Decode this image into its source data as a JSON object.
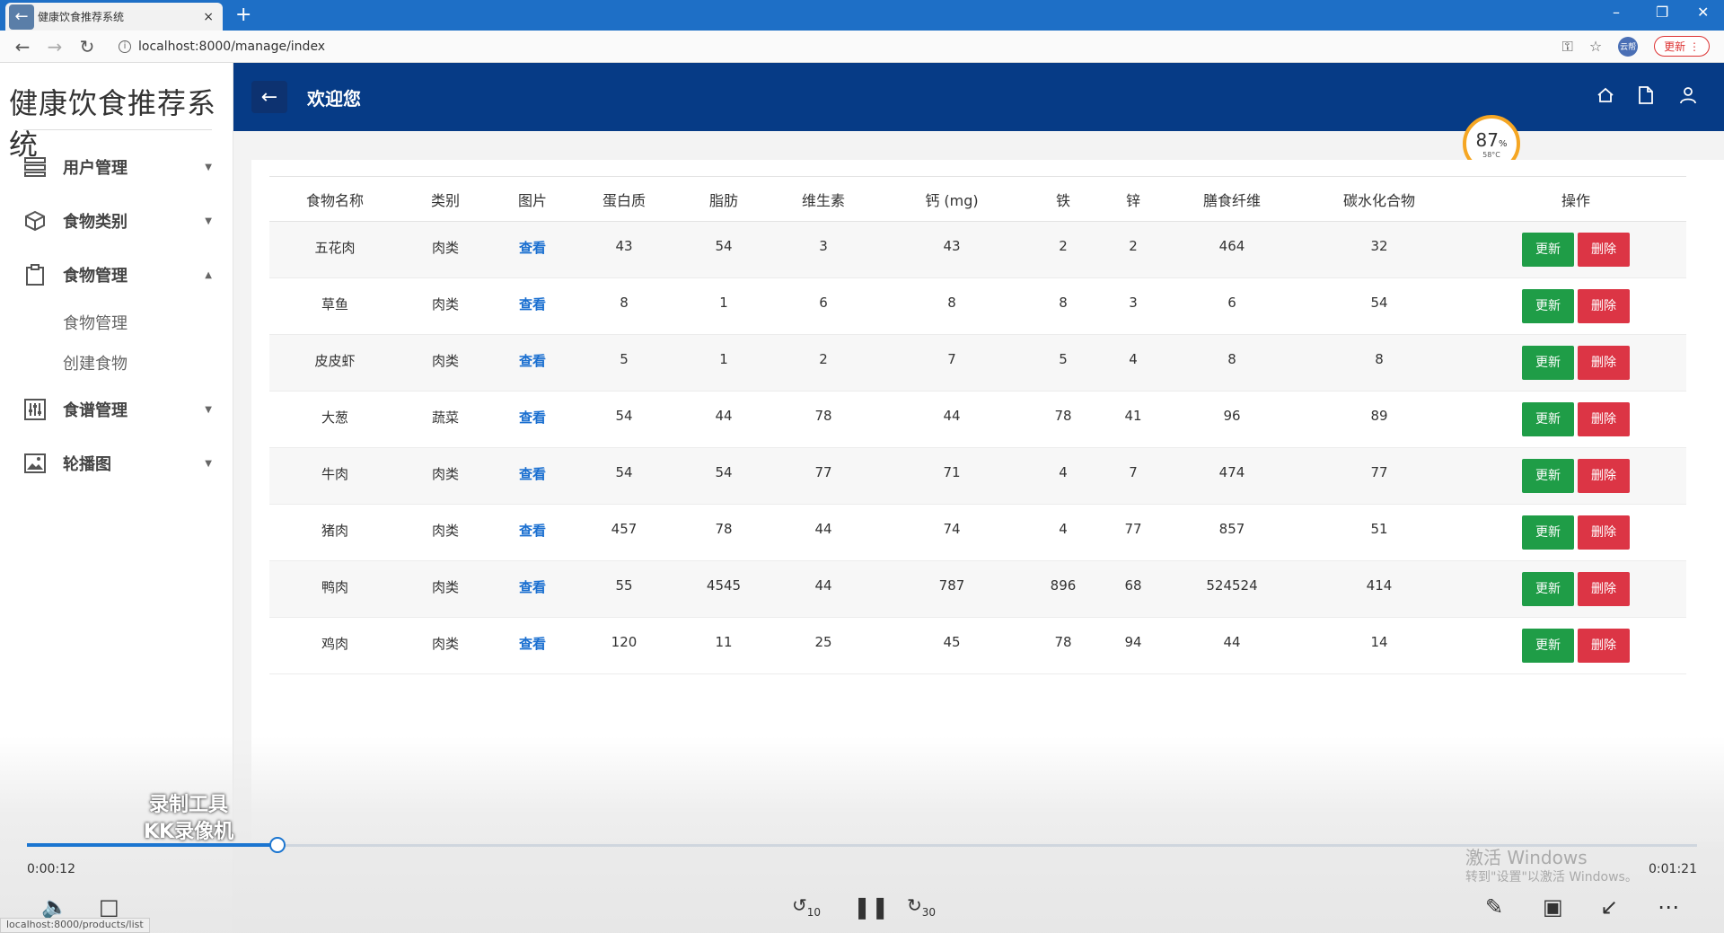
{
  "browser": {
    "tab_title": "健康饮食推荐系统",
    "tab_close": "×",
    "new_tab": "+",
    "url": "localhost:8000/manage/index",
    "update_label": "更新",
    "profile_label": "云帮"
  },
  "sidebar": {
    "app_title": "健康饮食推荐系统",
    "menu": [
      {
        "label": "用户管理",
        "icon": "list-icon"
      },
      {
        "label": "食物类别",
        "icon": "box-icon"
      },
      {
        "label": "食物管理",
        "icon": "clipboard-icon",
        "expanded": true,
        "children": [
          "食物管理",
          "创建食物"
        ]
      },
      {
        "label": "食谱管理",
        "icon": "sliders-icon"
      },
      {
        "label": "轮播图",
        "icon": "image-icon"
      }
    ]
  },
  "header": {
    "title": "欢迎您"
  },
  "badge": {
    "percent": "87",
    "percent_sign": "%",
    "temp": "58°C"
  },
  "table": {
    "columns": [
      "食物名称",
      "类别",
      "图片",
      "蛋白质",
      "脂肪",
      "维生素",
      "钙 (mg)",
      "铁",
      "锌",
      "膳食纤维",
      "碳水化合物",
      "操作"
    ],
    "view_label": "查看",
    "update_label": "更新",
    "delete_label": "删除",
    "rows": [
      {
        "name": "五花肉",
        "category": "肉类",
        "protein": "43",
        "fat": "54",
        "vitamin": "3",
        "calcium": "43",
        "iron": "2",
        "zinc": "2",
        "fiber": "464",
        "carbs": "32"
      },
      {
        "name": "草鱼",
        "category": "肉类",
        "protein": "8",
        "fat": "1",
        "vitamin": "6",
        "calcium": "8",
        "iron": "8",
        "zinc": "3",
        "fiber": "6",
        "carbs": "54"
      },
      {
        "name": "皮皮虾",
        "category": "肉类",
        "protein": "5",
        "fat": "1",
        "vitamin": "2",
        "calcium": "7",
        "iron": "5",
        "zinc": "4",
        "fiber": "8",
        "carbs": "8"
      },
      {
        "name": "大葱",
        "category": "蔬菜",
        "protein": "54",
        "fat": "44",
        "vitamin": "78",
        "calcium": "44",
        "iron": "78",
        "zinc": "41",
        "fiber": "96",
        "carbs": "89"
      },
      {
        "name": "牛肉",
        "category": "肉类",
        "protein": "54",
        "fat": "54",
        "vitamin": "77",
        "calcium": "71",
        "iron": "4",
        "zinc": "7",
        "fiber": "474",
        "carbs": "77"
      },
      {
        "name": "猪肉",
        "category": "肉类",
        "protein": "457",
        "fat": "78",
        "vitamin": "44",
        "calcium": "74",
        "iron": "4",
        "zinc": "77",
        "fiber": "857",
        "carbs": "51"
      },
      {
        "name": "鸭肉",
        "category": "肉类",
        "protein": "55",
        "fat": "4545",
        "vitamin": "44",
        "calcium": "787",
        "iron": "896",
        "zinc": "68",
        "fiber": "524524",
        "carbs": "414"
      },
      {
        "name": "鸡肉",
        "category": "肉类",
        "protein": "120",
        "fat": "11",
        "vitamin": "25",
        "calcium": "45",
        "iron": "78",
        "zinc": "94",
        "fiber": "44",
        "carbs": "14"
      }
    ]
  },
  "player": {
    "current_time": "0:00:12",
    "total_time": "0:01:21",
    "progress": 0.15,
    "watermark_line1": "录制工具",
    "watermark_line2": "KK录像机",
    "rewind_label": "10",
    "forward_label": "30",
    "activate_title": "激活 Windows",
    "activate_sub": "转到\"设置\"以激活 Windows。"
  },
  "statusbar": {
    "text": "localhost:8000/products/list"
  }
}
